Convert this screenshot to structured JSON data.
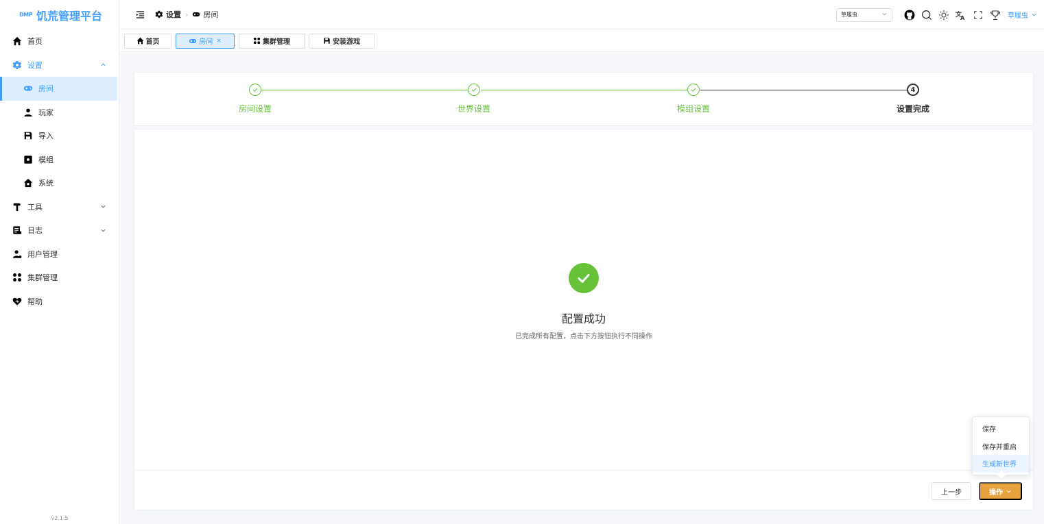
{
  "app": {
    "logo_mark": "DMP",
    "title": "饥荒管理平台",
    "version": "v2.1.5"
  },
  "sidebar": {
    "items": [
      {
        "label": "首页",
        "icon": "home-icon"
      },
      {
        "label": "设置",
        "icon": "gear-icon",
        "expanded": true
      },
      {
        "label": "房间",
        "icon": "gamepad-icon",
        "active": true
      },
      {
        "label": "玩家",
        "icon": "user-icon"
      },
      {
        "label": "导入",
        "icon": "save-icon"
      },
      {
        "label": "模组",
        "icon": "module-icon"
      },
      {
        "label": "系统",
        "icon": "house-icon"
      },
      {
        "label": "工具",
        "icon": "hammer-icon"
      },
      {
        "label": "日志",
        "icon": "log-icon"
      },
      {
        "label": "用户管理",
        "icon": "user-admin-icon"
      },
      {
        "label": "集群管理",
        "icon": "cluster-icon"
      },
      {
        "label": "帮助",
        "icon": "help-heart-icon"
      }
    ]
  },
  "header": {
    "breadcrumb": [
      "设置",
      "房间"
    ],
    "cluster_select": "草履虫",
    "user_name": "草履虫"
  },
  "tabs": [
    {
      "label": "首页"
    },
    {
      "label": "房间",
      "active": true,
      "close": "×"
    },
    {
      "label": "集群管理"
    },
    {
      "label": "安装游戏"
    }
  ],
  "steps": {
    "items": [
      {
        "title": "房间设置",
        "status": "done"
      },
      {
        "title": "世界设置",
        "status": "done"
      },
      {
        "title": "模组设置",
        "status": "done"
      },
      {
        "title": "设置完成",
        "status": "current",
        "number": "4"
      }
    ],
    "done_color": "#67c23a"
  },
  "result": {
    "title": "配置成功",
    "subtitle": "已完成所有配置，点击下方按钮执行不同操作"
  },
  "actions": {
    "prev_label": "上一步",
    "op_label": "操作",
    "dropdown": [
      "保存",
      "保存并重启",
      "生成新世界"
    ]
  },
  "colors": {
    "primary": "#409eff",
    "success": "#67c23a",
    "warning": "#e6a23c"
  }
}
